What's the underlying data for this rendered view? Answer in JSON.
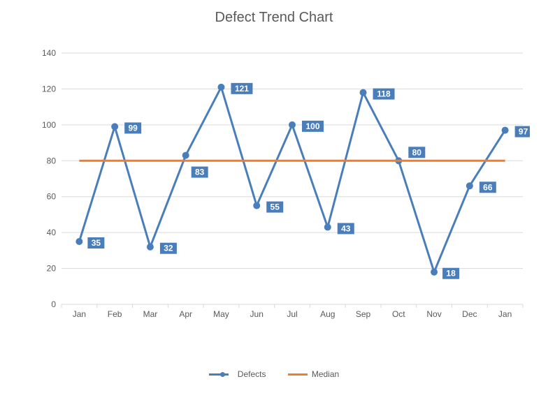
{
  "chart_data": {
    "type": "line",
    "title": "Defect Trend Chart",
    "xlabel": "",
    "ylabel": "",
    "ylim": [
      0,
      140
    ],
    "y_ticks": [
      0,
      20,
      40,
      60,
      80,
      100,
      120,
      140
    ],
    "categories": [
      "Jan",
      "Feb",
      "Mar",
      "Apr",
      "May",
      "Jun",
      "Jul",
      "Aug",
      "Sep",
      "Oct",
      "Nov",
      "Dec",
      "Jan"
    ],
    "series": [
      {
        "name": "Defects",
        "values": [
          35,
          99,
          32,
          83,
          121,
          55,
          100,
          43,
          118,
          80,
          18,
          66,
          97
        ],
        "color": "#4a7ebb",
        "markers": true,
        "data_labels": true
      },
      {
        "name": "Median",
        "values": [
          80,
          80,
          80,
          80,
          80,
          80,
          80,
          80,
          80,
          80,
          80,
          80,
          80
        ],
        "color": "#ed7d31",
        "markers": false,
        "data_labels": false
      }
    ],
    "legend": {
      "position": "bottom"
    }
  }
}
